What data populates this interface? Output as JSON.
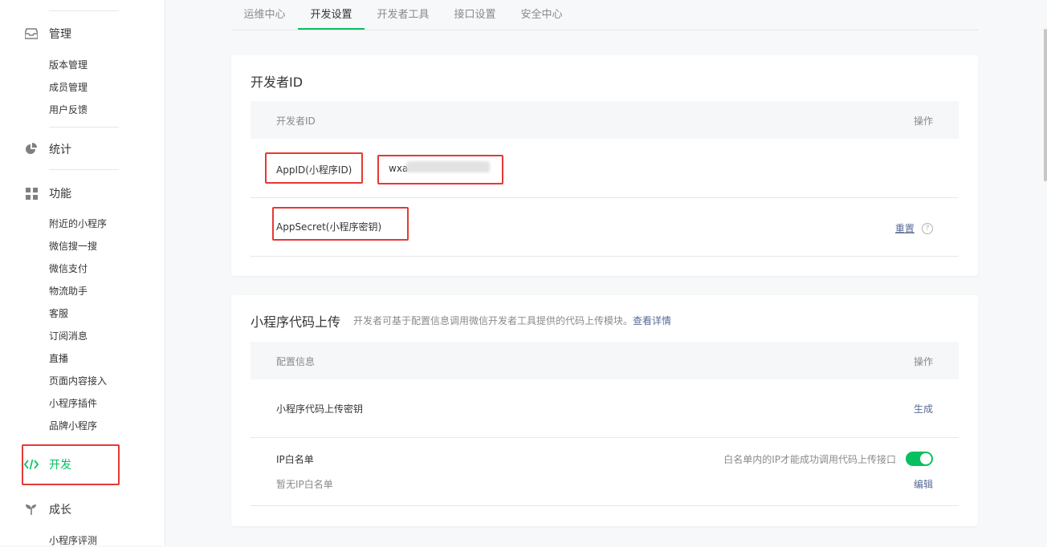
{
  "sidebar": {
    "manage": {
      "label": "管理",
      "icon": "inbox-icon",
      "items": [
        "版本管理",
        "成员管理",
        "用户反馈"
      ]
    },
    "stats": {
      "label": "统计",
      "icon": "pie-chart-icon"
    },
    "features": {
      "label": "功能",
      "icon": "grid-icon",
      "items": [
        "附近的小程序",
        "微信搜一搜",
        "微信支付",
        "物流助手",
        "客服",
        "订阅消息",
        "直播",
        "页面内容接入",
        "小程序插件",
        "品牌小程序"
      ]
    },
    "develop": {
      "label": "开发",
      "icon": "code-icon"
    },
    "growth": {
      "label": "成长",
      "icon": "sprout-icon",
      "items": [
        "小程序评测"
      ]
    }
  },
  "tabs": [
    "运维中心",
    "开发设置",
    "开发者工具",
    "接口设置",
    "安全中心"
  ],
  "active_tab": "开发设置",
  "developer_id": {
    "title": "开发者ID",
    "col_left": "开发者ID",
    "col_right": "操作",
    "appid_label": "AppID(小程序ID)",
    "appid_value": "wxa",
    "appsecret_label": "AppSecret(小程序密钥)",
    "reset_label": "重置",
    "help_glyph": "?"
  },
  "upload": {
    "title": "小程序代码上传",
    "desc": "开发者可基于配置信息调用微信开发者工具提供的代码上传模块。",
    "desc_link": "查看详情",
    "col_left": "配置信息",
    "col_right": "操作",
    "key_label": "小程序代码上传密钥",
    "generate_label": "生成",
    "ip_label": "IP白名单",
    "ip_empty": "暂无IP白名单",
    "ip_hint": "白名单内的IP才能成功调用代码上传接口",
    "ip_toggle_on": true,
    "edit_label": "编辑"
  },
  "colors": {
    "accent": "#07c160",
    "link": "#576b95",
    "highlight": "#e53935"
  }
}
